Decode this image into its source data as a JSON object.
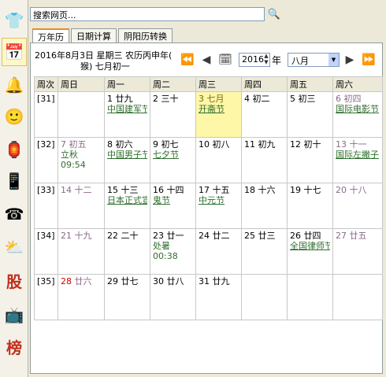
{
  "search": {
    "value": "搜索网页..."
  },
  "sidebar": {
    "items": [
      {
        "icon": "shirt-icon",
        "glyph": "👕"
      },
      {
        "icon": "calendar-icon",
        "glyph": "📅"
      },
      {
        "icon": "bell-icon",
        "glyph": "🔔"
      },
      {
        "icon": "avatar-icon",
        "glyph": "🙂"
      },
      {
        "icon": "lantern-icon",
        "glyph": "🏮"
      },
      {
        "icon": "phone-icon",
        "glyph": "📱"
      },
      {
        "icon": "telephone-icon",
        "glyph": "☎"
      },
      {
        "icon": "weather-icon",
        "glyph": "⛅"
      },
      {
        "icon": "stock-icon",
        "glyph": "股"
      },
      {
        "icon": "tv-icon",
        "glyph": "📺"
      },
      {
        "icon": "ranking-icon",
        "glyph": "榜"
      }
    ]
  },
  "tabs": [
    "万年历",
    "日期计算",
    "阴阳历转换"
  ],
  "header": {
    "date_line1": "2016年8月3日 星期三 农历丙申年(",
    "date_line2": "猴) 七月初一",
    "year": "2016",
    "year_label": "年",
    "month": "八月"
  },
  "calendar": {
    "headers": [
      "周次",
      "周日",
      "周一",
      "周二",
      "周三",
      "周四",
      "周五",
      "周六"
    ],
    "weeks": [
      {
        "label": "[31]",
        "days": [
          null,
          {
            "num": "1",
            "lunar": "廿九",
            "festival": "中国建军节"
          },
          {
            "num": "2",
            "lunar": "三十"
          },
          {
            "num": "3",
            "lunar": "七月",
            "festival": "开斋节",
            "today": true
          },
          {
            "num": "4",
            "lunar": "初二"
          },
          {
            "num": "5",
            "lunar": "初三"
          },
          {
            "num": "6",
            "lunar": "初四",
            "festival": "国际电影节"
          }
        ]
      },
      {
        "label": "[32]",
        "days": [
          {
            "num": "7",
            "lunar": "初五",
            "extra": "立秋",
            "extra2": "09:54"
          },
          {
            "num": "8",
            "lunar": "初六",
            "festival": "中国男子节"
          },
          {
            "num": "9",
            "lunar": "初七",
            "festival": "七夕节"
          },
          {
            "num": "10",
            "lunar": "初八"
          },
          {
            "num": "11",
            "lunar": "初九"
          },
          {
            "num": "12",
            "lunar": "初十"
          },
          {
            "num": "13",
            "lunar": "十一",
            "festival": "国际左撇子"
          }
        ]
      },
      {
        "label": "[33]",
        "days": [
          {
            "num": "14",
            "lunar": "十二"
          },
          {
            "num": "15",
            "lunar": "十三",
            "festival": "日本正式宣"
          },
          {
            "num": "16",
            "lunar": "十四",
            "festival": "鬼节"
          },
          {
            "num": "17",
            "lunar": "十五",
            "festival": "中元节"
          },
          {
            "num": "18",
            "lunar": "十六"
          },
          {
            "num": "19",
            "lunar": "十七"
          },
          {
            "num": "20",
            "lunar": "十八"
          }
        ]
      },
      {
        "label": "[34]",
        "days": [
          {
            "num": "21",
            "lunar": "十九"
          },
          {
            "num": "22",
            "lunar": "二十"
          },
          {
            "num": "23",
            "lunar": "廿一",
            "extra": "处暑",
            "extra2": "00:38"
          },
          {
            "num": "24",
            "lunar": "廿二"
          },
          {
            "num": "25",
            "lunar": "廿三"
          },
          {
            "num": "26",
            "lunar": "廿四",
            "festival": "全国律师节"
          },
          {
            "num": "27",
            "lunar": "廿五"
          }
        ]
      },
      {
        "label": "[35]",
        "days": [
          {
            "num": "28",
            "lunar": "廿六",
            "red": true
          },
          {
            "num": "29",
            "lunar": "廿七"
          },
          {
            "num": "30",
            "lunar": "廿八"
          },
          {
            "num": "31",
            "lunar": "廿九"
          },
          null,
          null,
          null
        ]
      }
    ]
  }
}
